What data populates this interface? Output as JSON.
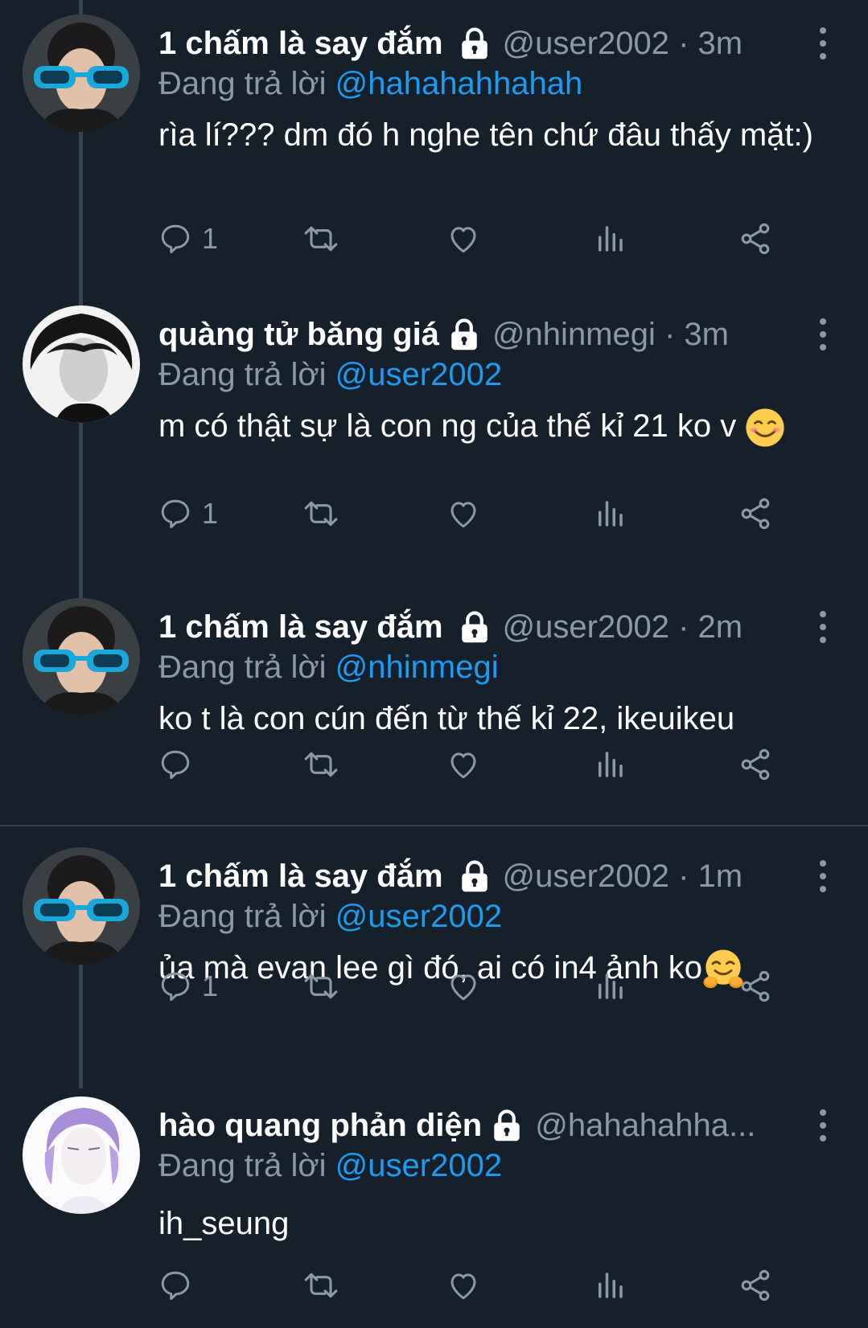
{
  "tweets": [
    {
      "name": "1 chấm là say đắm",
      "handle": "@user2002 · 3m",
      "reply_prefix": "Đang trả lời",
      "reply_to": "@hahahahhahah",
      "text": "rìa lí??? dm đó h nghe tên chứ đâu thấy mặt:)",
      "reply_count": "1",
      "avatar": "avatar-blue-sunglasses"
    },
    {
      "name": "quàng tử băng giá",
      "handle": "@nhinmegi · 3m",
      "reply_prefix": "Đang trả lời",
      "reply_to": "@user2002",
      "text": "m có thật sự là con ng của thế kỉ 21 ko v",
      "emoji": "smiling-face-emoji",
      "reply_count": "1",
      "avatar": "avatar-dark-hair"
    },
    {
      "name": "1 chấm là say đắm",
      "handle": "@user2002 · 2m",
      "reply_prefix": "Đang trả lời",
      "reply_to": "@nhinmegi",
      "text": "ko t là con cún đến từ thế kỉ 22, ikeuikeu",
      "reply_count": "",
      "avatar": "avatar-blue-sunglasses"
    },
    {
      "name": "1 chấm là say đắm",
      "handle": "@user2002 · 1m",
      "reply_prefix": "Đang trả lời",
      "reply_to": "@user2002",
      "text": "ủa mà evan lee gì đó, ai có in4 ảnh ko",
      "emoji": "hugging-face-emoji",
      "reply_count": "1",
      "avatar": "avatar-blue-sunglasses"
    },
    {
      "name": "hào quang phản diện",
      "handle": "@hahahahha...",
      "reply_prefix": "Đang trả lời",
      "reply_to": "@user2002",
      "text": "ih_seung",
      "reply_count": "",
      "avatar": "avatar-purple-hair"
    }
  ],
  "colors": {
    "background": "#15202b",
    "secondary_text": "#8b98a5",
    "mention": "#1d9bf0",
    "divider": "#38444d"
  }
}
